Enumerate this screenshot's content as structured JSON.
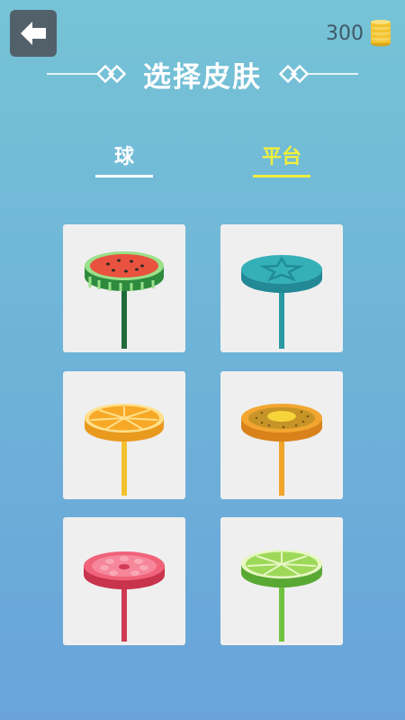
{
  "header": {
    "back_icon": "back-arrow-icon",
    "coin_count": "300",
    "coin_icon": "coin-stack-icon"
  },
  "title": "选择皮肤",
  "tabs": [
    {
      "label": "球",
      "active": false
    },
    {
      "label": "平台",
      "active": true
    }
  ],
  "skins": [
    {
      "name": "watermelon",
      "stick_color": "#1f6b3a"
    },
    {
      "name": "teal-star",
      "stick_color": "#2b9aa4"
    },
    {
      "name": "orange",
      "stick_color": "#f2c12e"
    },
    {
      "name": "cookie",
      "stick_color": "#f0a429"
    },
    {
      "name": "pomelo",
      "stick_color": "#d13a55"
    },
    {
      "name": "lime",
      "stick_color": "#72c241"
    }
  ]
}
